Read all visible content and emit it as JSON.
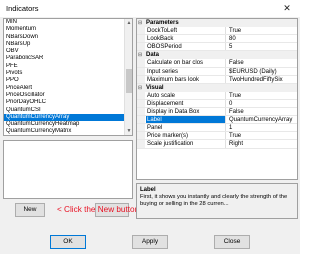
{
  "window": {
    "title": "Indicators",
    "close_glyph": "✕"
  },
  "list": {
    "items": [
      "MIN",
      "Momentum",
      "NBarsDown",
      "NBarsUp",
      "OBV",
      "ParabolicSAR",
      "PFE",
      "Pivots",
      "PPO",
      "PriceAlert",
      "PriceOscillator",
      "PriorDayOHLC",
      "QuantumCSI",
      "QuantumCurrencyArray",
      "QuantumCurrencyHeatmap",
      "QuantumCurrencyMatrix"
    ],
    "selected": "QuantumCurrencyArray",
    "scroll_up_glyph": "▲",
    "scroll_down_glyph": "▼"
  },
  "buttons": {
    "new": "New",
    "ok": "OK",
    "apply": "Apply",
    "close": "Close"
  },
  "annotation": "< Click the New button",
  "colors": {
    "selection": "#0078d7",
    "annotation": "#e81123"
  },
  "properties": {
    "categories": [
      {
        "name": "Parameters",
        "toggle": "⊟",
        "rows": [
          {
            "name": "DockToLeft",
            "value": "True"
          },
          {
            "name": "LookBack",
            "value": "80"
          },
          {
            "name": "OBOSPeriod",
            "value": "5"
          }
        ]
      },
      {
        "name": "Data",
        "toggle": "⊟",
        "rows": [
          {
            "name": "Calculate on bar clos",
            "value": "False"
          },
          {
            "name": "Input series",
            "value": "$EURUSD (Daily)"
          },
          {
            "name": "Maximum bars look",
            "value": "TwoHundredFiftySix"
          }
        ]
      },
      {
        "name": "Visual",
        "toggle": "⊟",
        "rows": [
          {
            "name": "Auto scale",
            "value": "True"
          },
          {
            "name": "Displacement",
            "value": "0"
          },
          {
            "name": "Display in Data Box",
            "value": "False"
          },
          {
            "name": "Label",
            "value": "QuantumCurrencyArray"
          },
          {
            "name": "Panel",
            "value": "1"
          },
          {
            "name": "Price marker(s)",
            "value": "True"
          },
          {
            "name": "Scale justification",
            "value": "Right"
          }
        ]
      }
    ],
    "selected_row": "Label"
  },
  "description": {
    "title": "Label",
    "text": "First, it shows you instantly and clearly the strength of the buying or selling in the 28 curren..."
  }
}
